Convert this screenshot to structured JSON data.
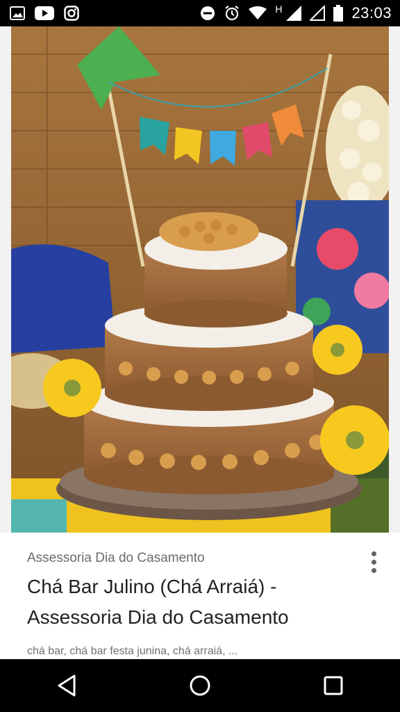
{
  "status_bar": {
    "time": "23:03",
    "network_label": "H",
    "left_icons": [
      "image-icon",
      "youtube-icon",
      "instagram-icon"
    ],
    "right_icons": [
      "do-not-disturb-icon",
      "alarm-icon",
      "wifi-icon",
      "signal-icon",
      "signal-empty-icon",
      "battery-icon"
    ]
  },
  "image": {
    "flag_colors": [
      "#4caf50",
      "#29a3a0",
      "#f2c522",
      "#3fa9e0",
      "#e24a6b",
      "#ef8b3a"
    ]
  },
  "card": {
    "source": "Assessoria Dia do Casamento",
    "title_line1": "Chá Bar Julino (Chá Arraiá) -",
    "title_line2": "Assessoria Dia do Casamento",
    "tags": "chá bar, chá bar festa junina, chá arraiá, ..."
  },
  "nav_bar": {
    "buttons": [
      "back-icon",
      "home-icon",
      "recents-icon"
    ]
  }
}
